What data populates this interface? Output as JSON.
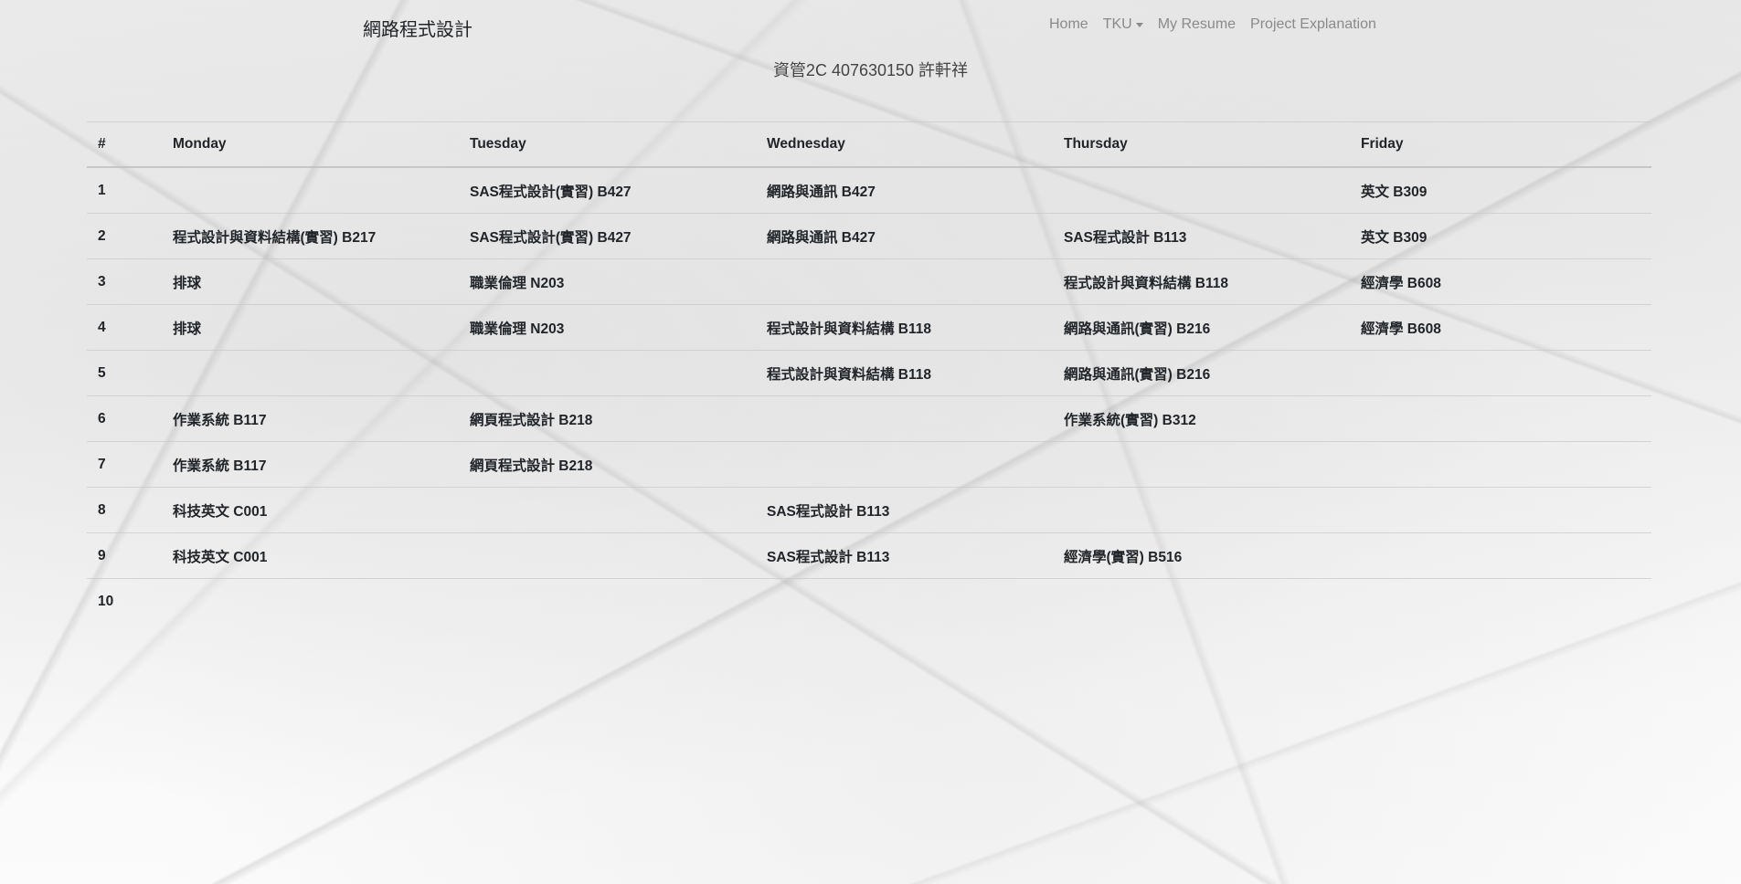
{
  "navbar": {
    "brand": "網路程式設計",
    "links": {
      "home": "Home",
      "tku": "TKU",
      "resume": "My Resume",
      "project": "Project Explanation"
    }
  },
  "subtitle": "資管2C 407630150 許軒祥",
  "schedule": {
    "headers": [
      "#",
      "Monday",
      "Tuesday",
      "Wednesday",
      "Thursday",
      "Friday"
    ],
    "rows": [
      [
        "1",
        "",
        "SAS程式設計(實習) B427",
        "網路與通訊 B427",
        "",
        "英文 B309"
      ],
      [
        "2",
        "程式設計與資料結構(實習) B217",
        "SAS程式設計(實習) B427",
        "網路與通訊 B427",
        "SAS程式設計 B113",
        "英文 B309"
      ],
      [
        "3",
        "排球",
        "職業倫理 N203",
        "",
        "程式設計與資料結構 B118",
        "經濟學 B608"
      ],
      [
        "4",
        "排球",
        "職業倫理 N203",
        "程式設計與資料結構 B118",
        "網路與通訊(實習) B216",
        "經濟學 B608"
      ],
      [
        "5",
        "",
        "",
        "程式設計與資料結構 B118",
        "網路與通訊(實習) B216",
        ""
      ],
      [
        "6",
        "作業系統 B117",
        "網頁程式設計 B218",
        "",
        "作業系統(實習) B312",
        ""
      ],
      [
        "7",
        "作業系統 B117",
        "網頁程式設計 B218",
        "",
        "",
        ""
      ],
      [
        "8",
        "科技英文 C001",
        "",
        "SAS程式設計 B113",
        "",
        ""
      ],
      [
        "9",
        "科技英文 C001",
        "",
        "SAS程式設計 B113",
        "經濟學(實習) B516",
        ""
      ],
      [
        "10",
        "",
        "",
        "",
        "",
        ""
      ]
    ]
  }
}
